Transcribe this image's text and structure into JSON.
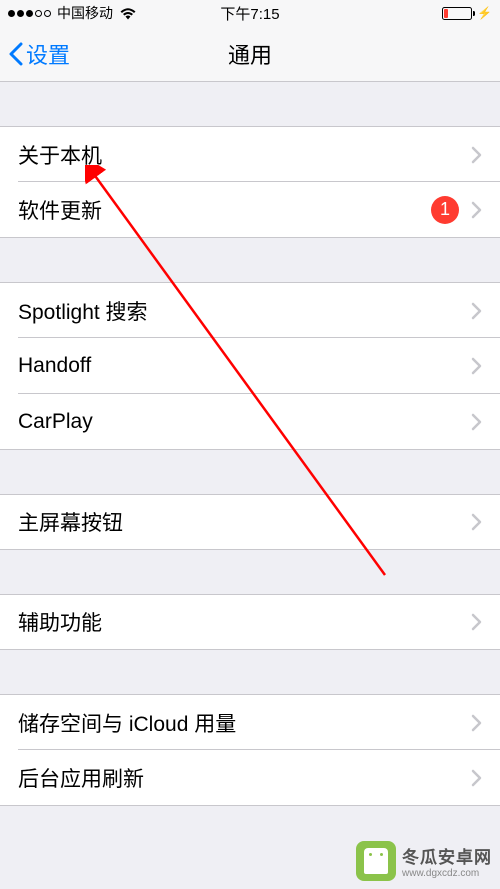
{
  "statusBar": {
    "carrier": "中国移动",
    "time": "下午7:15"
  },
  "nav": {
    "back": "设置",
    "title": "通用"
  },
  "groups": [
    {
      "items": [
        {
          "label": "关于本机",
          "badge": null
        },
        {
          "label": "软件更新",
          "badge": "1"
        }
      ]
    },
    {
      "items": [
        {
          "label": "Spotlight 搜索",
          "badge": null
        },
        {
          "label": "Handoff",
          "badge": null
        },
        {
          "label": "CarPlay",
          "badge": null
        }
      ]
    },
    {
      "items": [
        {
          "label": "主屏幕按钮",
          "badge": null
        }
      ]
    },
    {
      "items": [
        {
          "label": "辅助功能",
          "badge": null
        }
      ]
    },
    {
      "items": [
        {
          "label": "储存空间与 iCloud 用量",
          "badge": null
        },
        {
          "label": "后台应用刷新",
          "badge": null
        }
      ]
    }
  ],
  "watermark": {
    "main": "冬瓜安卓网",
    "sub": "www.dgxcdz.com"
  }
}
